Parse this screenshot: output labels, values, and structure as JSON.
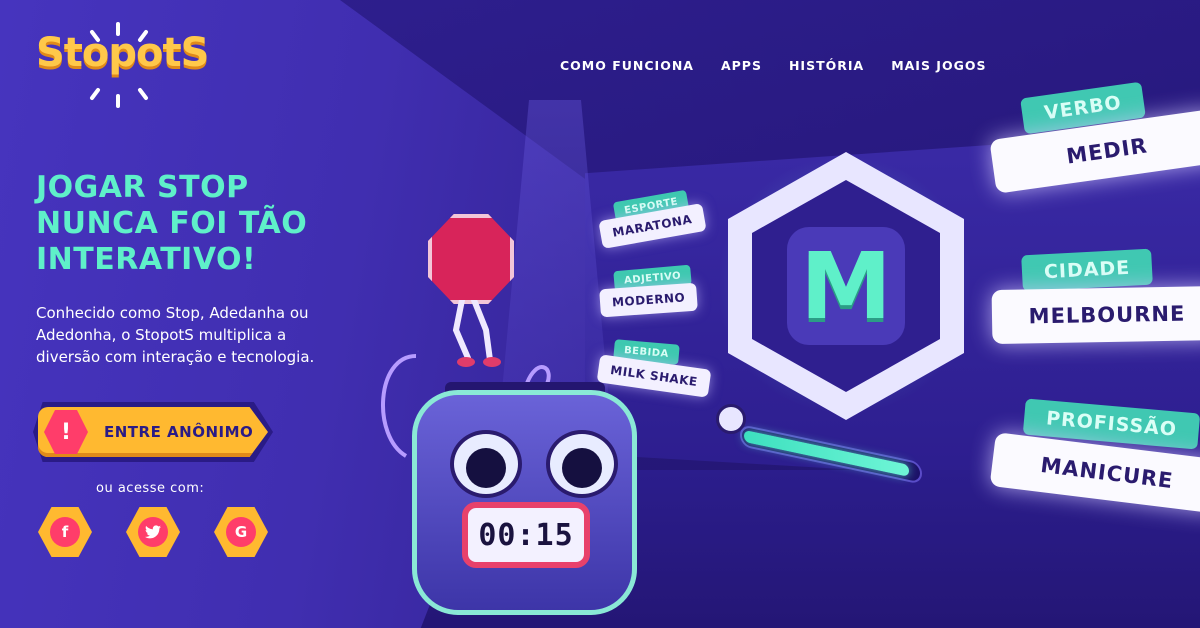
{
  "brand": {
    "logo_text": "StopotS"
  },
  "nav": {
    "items": [
      {
        "label": "COMO FUNCIONA"
      },
      {
        "label": "APPS"
      },
      {
        "label": "HISTÓRIA"
      },
      {
        "label": "MAIS JOGOS"
      }
    ]
  },
  "hero": {
    "title_lines": [
      "JOGAR STOP",
      "NUNCA FOI TÃO",
      "INTERATIVO!"
    ],
    "description": "Conhecido como Stop, Adedanha ou Adedonha, o StopotS multiplica a diversão com interação e tecnologia.",
    "cta_label": "ENTRE ANÔNIMO",
    "cta_icon": "!",
    "alt_login_label": "ou acesse com:",
    "social": [
      {
        "glyph": "f",
        "icon": "facebook-icon"
      },
      {
        "glyph": "t",
        "icon": "twitter-icon"
      },
      {
        "glyph": "G",
        "icon": "google-icon"
      }
    ]
  },
  "game": {
    "letter": "M",
    "timer": "00:15",
    "progress_fraction": 0.95,
    "mini_categories": [
      {
        "tag": "ESPORTE",
        "answer": "MARATONA"
      },
      {
        "tag": "ADJETIVO",
        "answer": "MODERNO"
      },
      {
        "tag": "BEBIDA",
        "answer": "MILK SHAKE"
      }
    ],
    "big_categories": [
      {
        "tag": "VERBO",
        "answer": "MEDIR"
      },
      {
        "tag": "CIDADE",
        "answer": "MELBOURNE"
      },
      {
        "tag": "PROFISSÃO",
        "answer": "MANICURE"
      }
    ]
  },
  "colors": {
    "background": "#3b2a9e",
    "accent_teal": "#5ff0c9",
    "accent_yellow": "#ffb930",
    "accent_red": "#ff3d6a"
  }
}
